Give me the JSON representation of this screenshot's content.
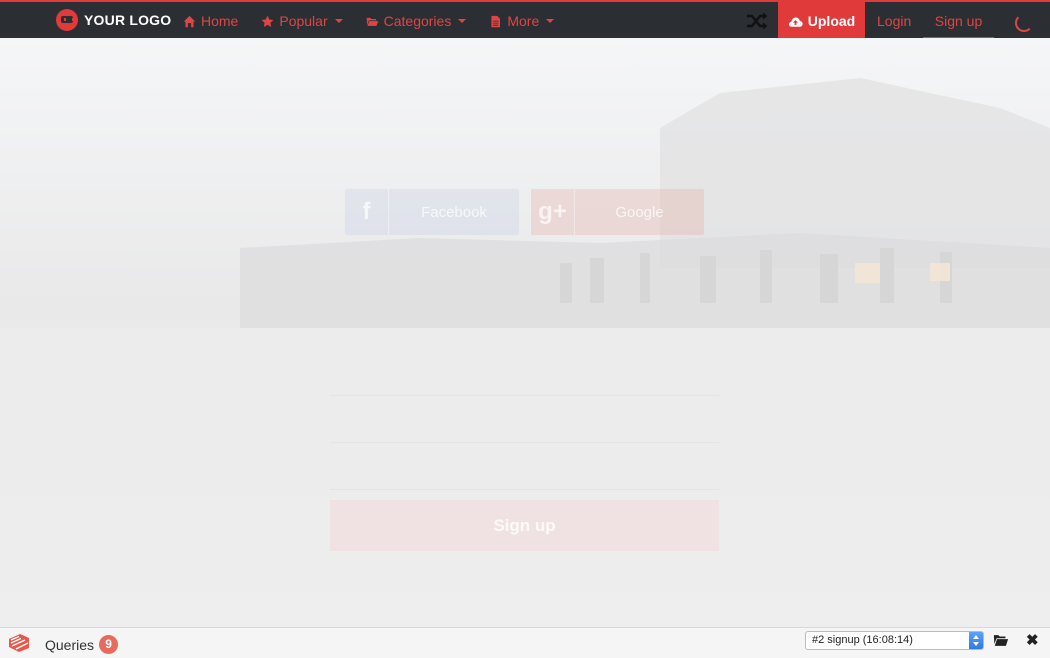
{
  "brand": {
    "logo_text": "YOUR LOGO"
  },
  "nav": {
    "items": [
      {
        "label": "Home",
        "icon": "home-icon",
        "dropdown": false
      },
      {
        "label": "Popular",
        "icon": "star-icon",
        "dropdown": true
      },
      {
        "label": "Categories",
        "icon": "folder-open-icon",
        "dropdown": true
      },
      {
        "label": "More",
        "icon": "file-icon",
        "dropdown": true
      }
    ],
    "upload_label": "Upload",
    "login_label": "Login",
    "signup_label": "Sign up"
  },
  "form": {
    "facebook_label": "Facebook",
    "google_label": "Google",
    "signup_button_label": "Sign up"
  },
  "debugbar": {
    "queries_label": "Queries",
    "queries_count": "9",
    "request_select_value": "#2 signup (16:08:14)"
  },
  "colors": {
    "accent": "#e03a3a",
    "nav_bg": "#2b2e33",
    "nav_text": "#e04545"
  }
}
